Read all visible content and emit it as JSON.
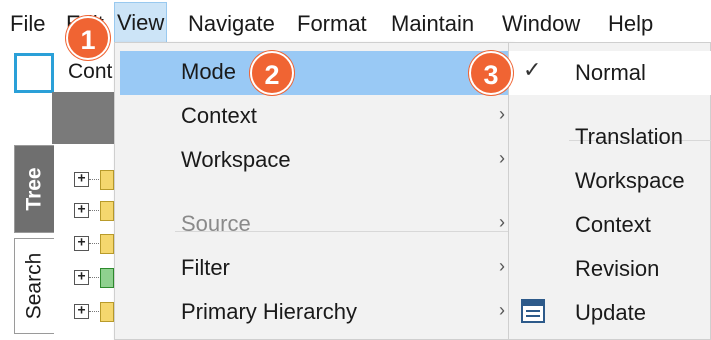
{
  "menubar": {
    "items": [
      {
        "label": "File"
      },
      {
        "label": "Edit"
      },
      {
        "label": "View"
      },
      {
        "label": "Navigate"
      },
      {
        "label": "Format"
      },
      {
        "label": "Maintain"
      },
      {
        "label": "Window"
      },
      {
        "label": "Help"
      }
    ]
  },
  "toolbar": {
    "visible_text": "Cont"
  },
  "side_tabs": {
    "tree": "Tree",
    "search": "Search"
  },
  "view_menu": {
    "items": [
      {
        "label": "Mode",
        "submenu": true,
        "highlighted": true
      },
      {
        "label": "Context",
        "submenu": true
      },
      {
        "label": "Workspace",
        "submenu": true
      },
      {
        "label": "Source",
        "submenu": true,
        "disabled": true
      },
      {
        "label": "Filter",
        "submenu": true
      },
      {
        "label": "Primary Hierarchy",
        "submenu": true
      }
    ]
  },
  "mode_submenu": {
    "items": [
      {
        "label": "Normal",
        "checked": true
      },
      {
        "label": "Translation"
      },
      {
        "label": "Workspace"
      },
      {
        "label": "Context"
      },
      {
        "label": "Revision"
      },
      {
        "label": "Update",
        "icon": "update-view-icon"
      }
    ],
    "check_glyph": "✓"
  },
  "callouts": [
    "1",
    "2",
    "3"
  ],
  "colors": {
    "menu_highlight": "#99c9f5",
    "menubar_active": "#cce4f7",
    "callout": "#f06433",
    "tree_tab": "#6f6f6f"
  }
}
